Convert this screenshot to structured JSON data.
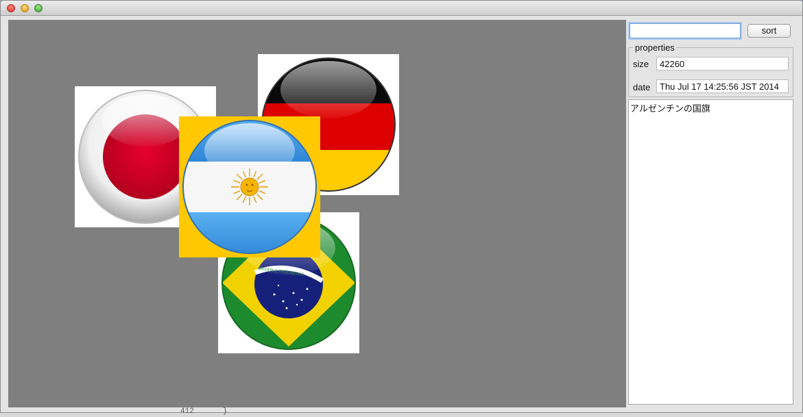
{
  "window": {
    "title": "",
    "controls": [
      "close-icon",
      "minimize-icon",
      "zoom-icon"
    ]
  },
  "canvas": {
    "background": "#808080",
    "flags": [
      {
        "name": "japan",
        "country": "Japan"
      },
      {
        "name": "germany",
        "country": "Germany"
      },
      {
        "name": "brazil",
        "country": "Brazil",
        "motto": "ORDEM E PROGRESSO"
      },
      {
        "name": "argentina",
        "country": "Argentina",
        "selected": true,
        "highlight": "#ffc800"
      }
    ]
  },
  "panel": {
    "search": {
      "value": "",
      "placeholder": ""
    },
    "sort_label": "sort",
    "properties": {
      "legend": "properties",
      "size_label": "size",
      "size_value": "42260",
      "date_label": "date",
      "date_value": "Thu Jul 17 14:25:56 JST 2014"
    },
    "description": "アルゼンチンの国旗"
  },
  "background": {
    "line_number": "412",
    "brace": "}"
  }
}
